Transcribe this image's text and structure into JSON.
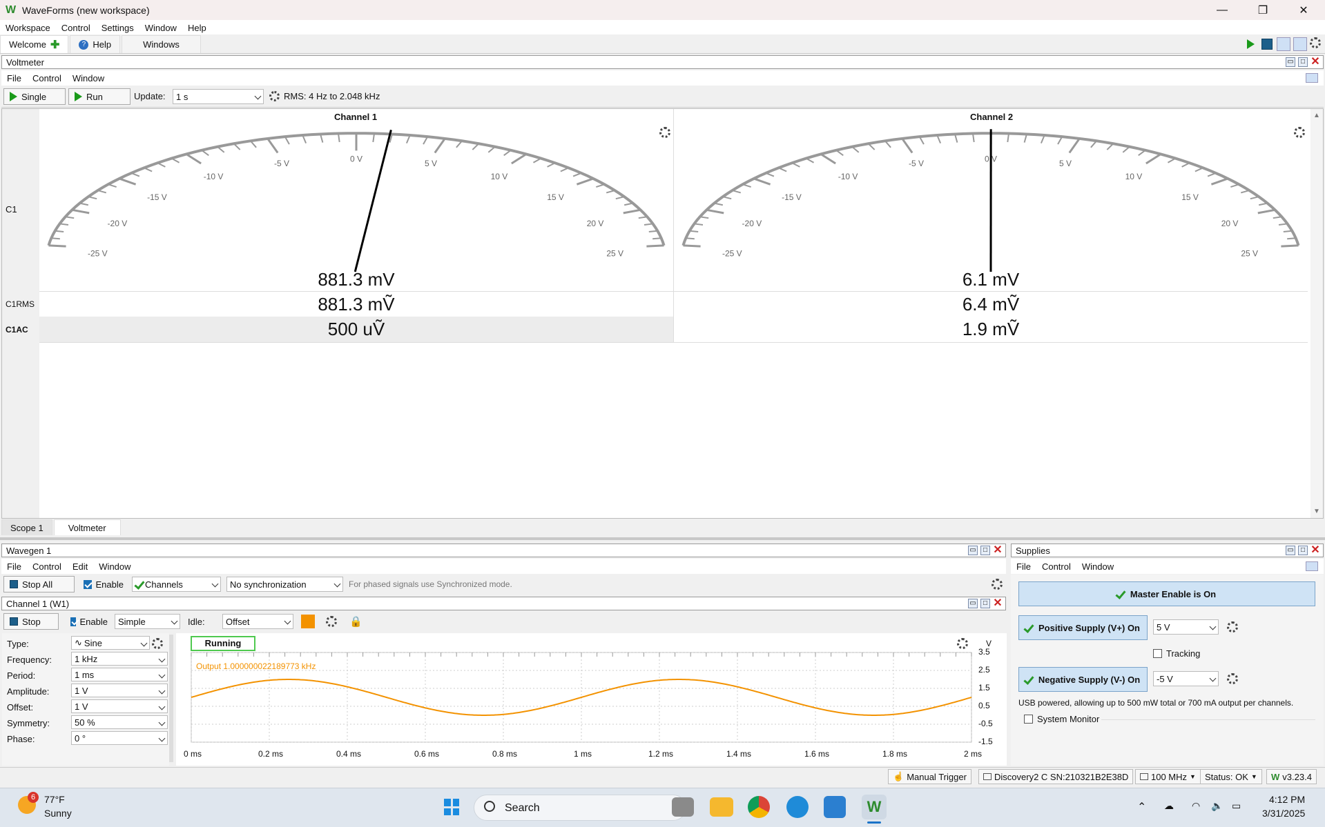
{
  "app": {
    "title": "WaveForms (new workspace)",
    "logo_color": "#2e8b2e"
  },
  "menu": [
    "Workspace",
    "Control",
    "Settings",
    "Window",
    "Help"
  ],
  "tabs": {
    "welcome": "Welcome",
    "help": "Help",
    "windows": "Windows"
  },
  "voltmeter": {
    "title": "Voltmeter",
    "menu": [
      "File",
      "Control",
      "Window"
    ],
    "single": "Single",
    "run": "Run",
    "update_label": "Update:",
    "update_value": "1 s",
    "rms_info": "RMS: 4 Hz to 2.048 kHz",
    "row_labels": {
      "c1": "C1",
      "c1rms": "C1RMS",
      "c1ac": "C1AC"
    },
    "scale_labels": [
      "-25 V",
      "-20 V",
      "-15 V",
      "-10 V",
      "-5 V",
      "0 V",
      "5 V",
      "10 V",
      "15 V",
      "20 V",
      "25 V"
    ],
    "channel1": {
      "name": "Channel 1",
      "dc": "881.3 mV",
      "rms": "881.3 mṼ",
      "ac": "500 uṼ",
      "needle_value": 0.8813
    },
    "channel2": {
      "name": "Channel 2",
      "dc": "6.1 mV",
      "rms": "6.4 mṼ",
      "ac": "1.9 mṼ",
      "needle_value": 0.0061
    }
  },
  "bottom_tabs": [
    "Scope 1",
    "Voltmeter"
  ],
  "wavegen": {
    "title": "Wavegen 1",
    "menu": [
      "File",
      "Control",
      "Edit",
      "Window"
    ],
    "stop_all": "Stop All",
    "enable": "Enable",
    "channels": "Channels",
    "sync": "No synchronization",
    "hint": "For phased signals use Synchronized mode.",
    "channel_title": "Channel 1 (W1)",
    "stop": "Stop",
    "mode": "Simple",
    "idle_label": "Idle:",
    "idle_value": "Offset",
    "accent": "#f39200",
    "params": [
      {
        "label": "Type:",
        "value": "Sine"
      },
      {
        "label": "Frequency:",
        "value": "1 kHz"
      },
      {
        "label": "Period:",
        "value": "1 ms"
      },
      {
        "label": "Amplitude:",
        "value": "1 V"
      },
      {
        "label": "Offset:",
        "value": "1 V"
      },
      {
        "label": "Symmetry:",
        "value": "50 %"
      },
      {
        "label": "Phase:",
        "value": "0 °"
      }
    ],
    "plot": {
      "status": "Running",
      "output_text": "Output 1.000000022189773 kHz",
      "yunit": "V",
      "yticks": [
        "3.5",
        "2.5",
        "1.5",
        "0.5",
        "-0.5",
        "-1.5"
      ],
      "xticks": [
        "0 ms",
        "0.2 ms",
        "0.4 ms",
        "0.6 ms",
        "0.8 ms",
        "1 ms",
        "1.2 ms",
        "1.4 ms",
        "1.6 ms",
        "1.8 ms",
        "2 ms"
      ]
    }
  },
  "supplies": {
    "title": "Supplies",
    "menu": [
      "File",
      "Control",
      "Window"
    ],
    "master": "Master Enable is On",
    "positive": "Positive Supply (V+) On",
    "positive_value": "5 V",
    "tracking": "Tracking",
    "negative": "Negative Supply (V-) On",
    "negative_value": "-5 V",
    "info": "USB powered, allowing up to 500 mW total or 700 mA output per channels.",
    "system_monitor": "System Monitor"
  },
  "statusbar": {
    "manual_trigger": "Manual Trigger",
    "device": "Discovery2 C SN:210321B2E38D",
    "clock": "100 MHz",
    "status": "Status: OK",
    "version": "v3.23.4"
  },
  "taskbar": {
    "weather_temp": "77°F",
    "weather_desc": "Sunny",
    "weather_badge": "6",
    "search": "Search",
    "time": "4:12 PM",
    "date": "3/31/2025"
  }
}
